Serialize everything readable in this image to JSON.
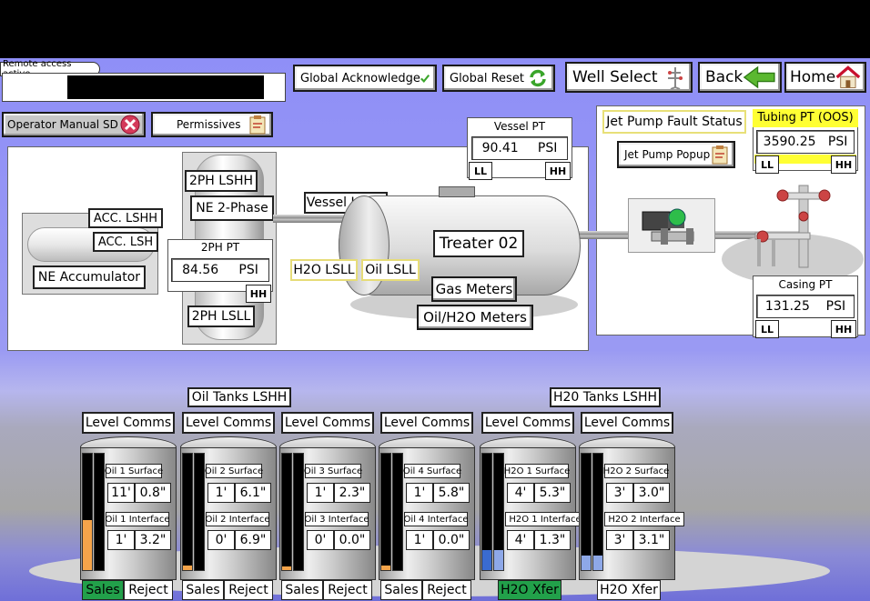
{
  "header": {
    "remote_access": "Remote access active",
    "global_ack": "Global Acknowledge",
    "global_reset": "Global Reset",
    "well_select": "Well Select",
    "back": "Back",
    "home": "Home"
  },
  "toolbar": {
    "operator_sd": "Operator Manual SD",
    "permissives": "Permissives"
  },
  "process": {
    "accumulator": {
      "lshh": "ACC. LSHH",
      "lsh": "ACC. LSH",
      "name": "NE Accumulator"
    },
    "two_phase": {
      "lshh": "2PH LSHH",
      "name": "NE 2-Phase",
      "pt_label": "2PH PT",
      "pt_value": "84.56",
      "pt_unit": "PSI",
      "hh": "HH",
      "lsll": "2PH LSLL"
    },
    "vessel_pt": {
      "label": "Vessel PT",
      "value": "90.41",
      "unit": "PSI",
      "ll": "LL",
      "hh": "HH"
    },
    "vessel_lshh": "Vessel LSHH",
    "treater": "Treater 02",
    "h2o_lsll": "H2O LSLL",
    "oil_lsll": "Oil LSLL",
    "gas_meters": "Gas Meters",
    "oil_h2o_meters": "Oil/H2O Meters",
    "jet_pump_fault": "Jet Pump Fault Status",
    "jet_pump_popup": "Jet Pump Popup",
    "tubing_pt": {
      "label": "Tubing PT (OOS)",
      "value": "3590.25",
      "unit": "PSI",
      "ll": "LL",
      "hh": "HH"
    },
    "casing_pt": {
      "label": "Casing PT",
      "value": "131.25",
      "unit": "PSI",
      "ll": "LL",
      "hh": "HH"
    }
  },
  "tanks_section": {
    "oil_lshh": "Oil Tanks LSHH",
    "h2o_lshh": "H20 Tanks LSHH",
    "level_comms": "Level Comms",
    "sales": "Sales",
    "reject": "Reject",
    "h2o_xfer": "H2O Xfer"
  },
  "tanks": [
    {
      "surface_label": "Oil 1 Surface",
      "surface_ft": "11'",
      "surface_in": "0.8\"",
      "interface_label": "Oil 1 Interface",
      "interface_ft": "1'",
      "interface_in": "3.2\"",
      "level_fraction": 0.42,
      "interface_fraction": 0.0,
      "fill_color": "#f5a44a",
      "type": "oil",
      "sales_active": true
    },
    {
      "surface_label": "Oil 2 Surface",
      "surface_ft": "1'",
      "surface_in": "6.1\"",
      "interface_label": "Oil 2 Interface",
      "interface_ft": "0'",
      "interface_in": "6.9\"",
      "level_fraction": 0.04,
      "interface_fraction": 0.0,
      "fill_color": "#f5a44a",
      "type": "oil",
      "sales_active": false
    },
    {
      "surface_label": "Oil 3 Surface",
      "surface_ft": "1'",
      "surface_in": "2.3\"",
      "interface_label": "Oil 3 Interface",
      "interface_ft": "0'",
      "interface_in": "0.0\"",
      "level_fraction": 0.03,
      "interface_fraction": 0.0,
      "fill_color": "#f5a44a",
      "type": "oil",
      "sales_active": false
    },
    {
      "surface_label": "Oil 4 Surface",
      "surface_ft": "1'",
      "surface_in": "5.8\"",
      "interface_label": "Oil 4 Interface",
      "interface_ft": "1'",
      "interface_in": "0.0\"",
      "level_fraction": 0.04,
      "interface_fraction": 0.0,
      "fill_color": "#f5a44a",
      "type": "oil",
      "sales_active": false
    },
    {
      "surface_label": "H2O 1 Surface",
      "surface_ft": "4'",
      "surface_in": "5.3\"",
      "interface_label": "H2O 1 Interface",
      "interface_ft": "4'",
      "interface_in": "1.3\"",
      "level_fraction": 0.17,
      "interface_fraction": 0.17,
      "fill_color": "#3a6bd0",
      "type": "h2o",
      "xfer_active": true
    },
    {
      "surface_label": "H2O 2 Surface",
      "surface_ft": "3'",
      "surface_in": "3.0\"",
      "interface_label": "H2O 2 Interface",
      "interface_ft": "3'",
      "interface_in": "3.1\"",
      "level_fraction": 0.12,
      "interface_fraction": 0.12,
      "fill_color": "#8ea8e8",
      "type": "h2o",
      "xfer_active": false
    }
  ],
  "colors": {
    "active_green": "#22a04a",
    "yellow_status": "#ffff33",
    "alarm_red": "#c8102e"
  }
}
